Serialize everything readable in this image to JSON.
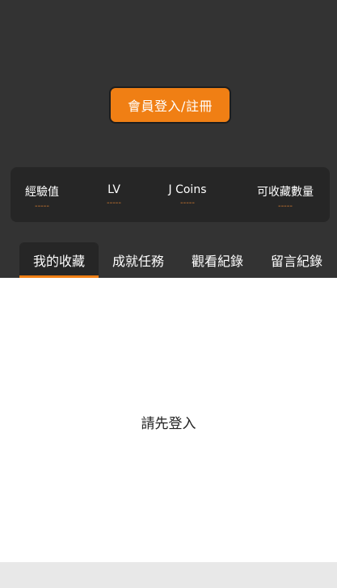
{
  "header": {
    "login_button_label": "會員登入/註冊"
  },
  "stats": [
    {
      "label": "經驗值",
      "value": "-----"
    },
    {
      "label": "LV",
      "value": "-----"
    },
    {
      "label": "J Coins",
      "value": "-----"
    },
    {
      "label": "可收藏數量",
      "value": "-----"
    }
  ],
  "tabs": [
    {
      "label": "我的收藏",
      "active": true
    },
    {
      "label": "成就任務",
      "active": false
    },
    {
      "label": "觀看紀錄",
      "active": false
    },
    {
      "label": "留言紀錄",
      "active": false
    }
  ],
  "content": {
    "message": "請先登入"
  },
  "colors": {
    "accent": "#f07f14",
    "header_bg": "#333333",
    "panel_bg": "#262626"
  }
}
